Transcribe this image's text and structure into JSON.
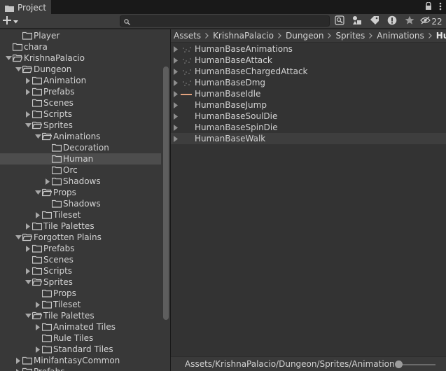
{
  "window": {
    "tab_label": "Project",
    "tab_icon": "folder-icon",
    "tab_icons": [
      "lock-icon",
      "kebab-menu-icon"
    ]
  },
  "toolbar": {
    "create_icon": "plus-icon",
    "search": {
      "value": "",
      "placeholder": ""
    },
    "buttons": [
      "search-by-type-icon",
      "filter-by-type-icon",
      "filter-by-label-icon",
      "errors-icon",
      "favorites-star-icon",
      "hidden-packages-icon"
    ],
    "hidden_count": "22"
  },
  "tree": [
    {
      "label": "Player",
      "depth": 2,
      "arrow": "none",
      "open": false,
      "selected": false
    },
    {
      "label": "chara",
      "depth": 1,
      "arrow": "none",
      "open": false,
      "selected": false
    },
    {
      "label": "KrishnaPalacio",
      "depth": 1,
      "arrow": "down",
      "open": true,
      "selected": false
    },
    {
      "label": "Dungeon",
      "depth": 2,
      "arrow": "down",
      "open": true,
      "selected": false
    },
    {
      "label": "Animation",
      "depth": 3,
      "arrow": "right",
      "open": false,
      "selected": false
    },
    {
      "label": "Prefabs",
      "depth": 3,
      "arrow": "right",
      "open": false,
      "selected": false
    },
    {
      "label": "Scenes",
      "depth": 3,
      "arrow": "none",
      "open": false,
      "selected": false
    },
    {
      "label": "Scripts",
      "depth": 3,
      "arrow": "right",
      "open": false,
      "selected": false
    },
    {
      "label": "Sprites",
      "depth": 3,
      "arrow": "down",
      "open": true,
      "selected": false
    },
    {
      "label": "Animations",
      "depth": 4,
      "arrow": "down",
      "open": true,
      "selected": false
    },
    {
      "label": "Decoration",
      "depth": 5,
      "arrow": "none",
      "open": false,
      "selected": false
    },
    {
      "label": "Human",
      "depth": 5,
      "arrow": "none",
      "open": false,
      "selected": true
    },
    {
      "label": "Orc",
      "depth": 5,
      "arrow": "none",
      "open": false,
      "selected": false
    },
    {
      "label": "Shadows",
      "depth": 5,
      "arrow": "right",
      "open": false,
      "selected": false
    },
    {
      "label": "Props",
      "depth": 4,
      "arrow": "down",
      "open": true,
      "selected": false
    },
    {
      "label": "Shadows",
      "depth": 5,
      "arrow": "none",
      "open": false,
      "selected": false
    },
    {
      "label": "Tileset",
      "depth": 4,
      "arrow": "right",
      "open": false,
      "selected": false
    },
    {
      "label": "Tile Palettes",
      "depth": 3,
      "arrow": "right",
      "open": false,
      "selected": false
    },
    {
      "label": "Forgotten Plains",
      "depth": 2,
      "arrow": "down",
      "open": true,
      "selected": false
    },
    {
      "label": "Prefabs",
      "depth": 3,
      "arrow": "right",
      "open": false,
      "selected": false
    },
    {
      "label": "Scenes",
      "depth": 3,
      "arrow": "none",
      "open": false,
      "selected": false
    },
    {
      "label": "Scripts",
      "depth": 3,
      "arrow": "right",
      "open": false,
      "selected": false
    },
    {
      "label": "Sprites",
      "depth": 3,
      "arrow": "down",
      "open": true,
      "selected": false
    },
    {
      "label": "Props",
      "depth": 4,
      "arrow": "none",
      "open": false,
      "selected": false
    },
    {
      "label": "Tileset",
      "depth": 4,
      "arrow": "right",
      "open": false,
      "selected": false
    },
    {
      "label": "Tile Palettes",
      "depth": 3,
      "arrow": "down",
      "open": true,
      "selected": false
    },
    {
      "label": "Animated Tiles",
      "depth": 4,
      "arrow": "right",
      "open": false,
      "selected": false
    },
    {
      "label": "Rule Tiles",
      "depth": 4,
      "arrow": "none",
      "open": false,
      "selected": false
    },
    {
      "label": "Standard Tiles",
      "depth": 4,
      "arrow": "right",
      "open": false,
      "selected": false
    },
    {
      "label": "MinifantasyCommon",
      "depth": 2,
      "arrow": "right",
      "open": false,
      "selected": false
    },
    {
      "label": "Prefabs",
      "depth": 2,
      "arrow": "right",
      "open": false,
      "selected": false
    }
  ],
  "breadcrumbs": [
    "Assets",
    "KrishnaPalacio",
    "Dungeon",
    "Sprites",
    "Animations",
    "Hum"
  ],
  "assets": [
    {
      "label": "HumanBaseAnimations",
      "thumb": "dots",
      "selected": false
    },
    {
      "label": "HumanBaseAttack",
      "thumb": "dots",
      "selected": false
    },
    {
      "label": "HumanBaseChargedAttack",
      "thumb": "dots",
      "selected": false
    },
    {
      "label": "HumanBaseDmg",
      "thumb": "dots",
      "selected": false
    },
    {
      "label": "HumanBaseIdle",
      "thumb": "bar",
      "selected": false
    },
    {
      "label": "HumanBaseJump",
      "thumb": "none",
      "selected": false
    },
    {
      "label": "HumanBaseSoulDie",
      "thumb": "none",
      "selected": false
    },
    {
      "label": "HumanBaseSpinDie",
      "thumb": "none",
      "selected": false
    },
    {
      "label": "HumanBaseWalk",
      "thumb": "none",
      "selected": true
    }
  ],
  "status": {
    "path": "Assets/KrishnaPalacio/Dungeon/Sprites/Animations/Human",
    "zoom_slider_icon": "zoom-slider"
  },
  "colors": {
    "background": "#282828",
    "panel": "#383838",
    "selection": "#4d4d4d",
    "idle_thumb": "#e2a27e"
  }
}
